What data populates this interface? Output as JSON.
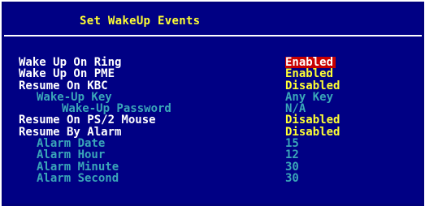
{
  "title": "Set WakeUp Events",
  "colors": {
    "background": "#000084",
    "title": "#ffff33",
    "enabled_label": "#ffffff",
    "disabled_label": "#3aa6b8",
    "value": "#ffff33",
    "highlight_bg": "#c80000"
  },
  "rows": [
    {
      "label": "Wake Up On Ring",
      "value": "Enabled"
    },
    {
      "label": "Wake Up On PME",
      "value": "Enabled"
    },
    {
      "label": "Resume On KBC",
      "value": "Disabled"
    },
    {
      "label": "Wake-Up Key",
      "value": "Any Key"
    },
    {
      "label": "Wake-Up Password",
      "value": "N/A"
    },
    {
      "label": "Resume On PS/2 Mouse",
      "value": "Disabled"
    },
    {
      "label": "Resume By Alarm",
      "value": "Disabled"
    },
    {
      "label": "Alarm Date",
      "value": "15"
    },
    {
      "label": "Alarm Hour",
      "value": "12"
    },
    {
      "label": "Alarm Minute",
      "value": "30"
    },
    {
      "label": "Alarm Second",
      "value": "30"
    }
  ]
}
